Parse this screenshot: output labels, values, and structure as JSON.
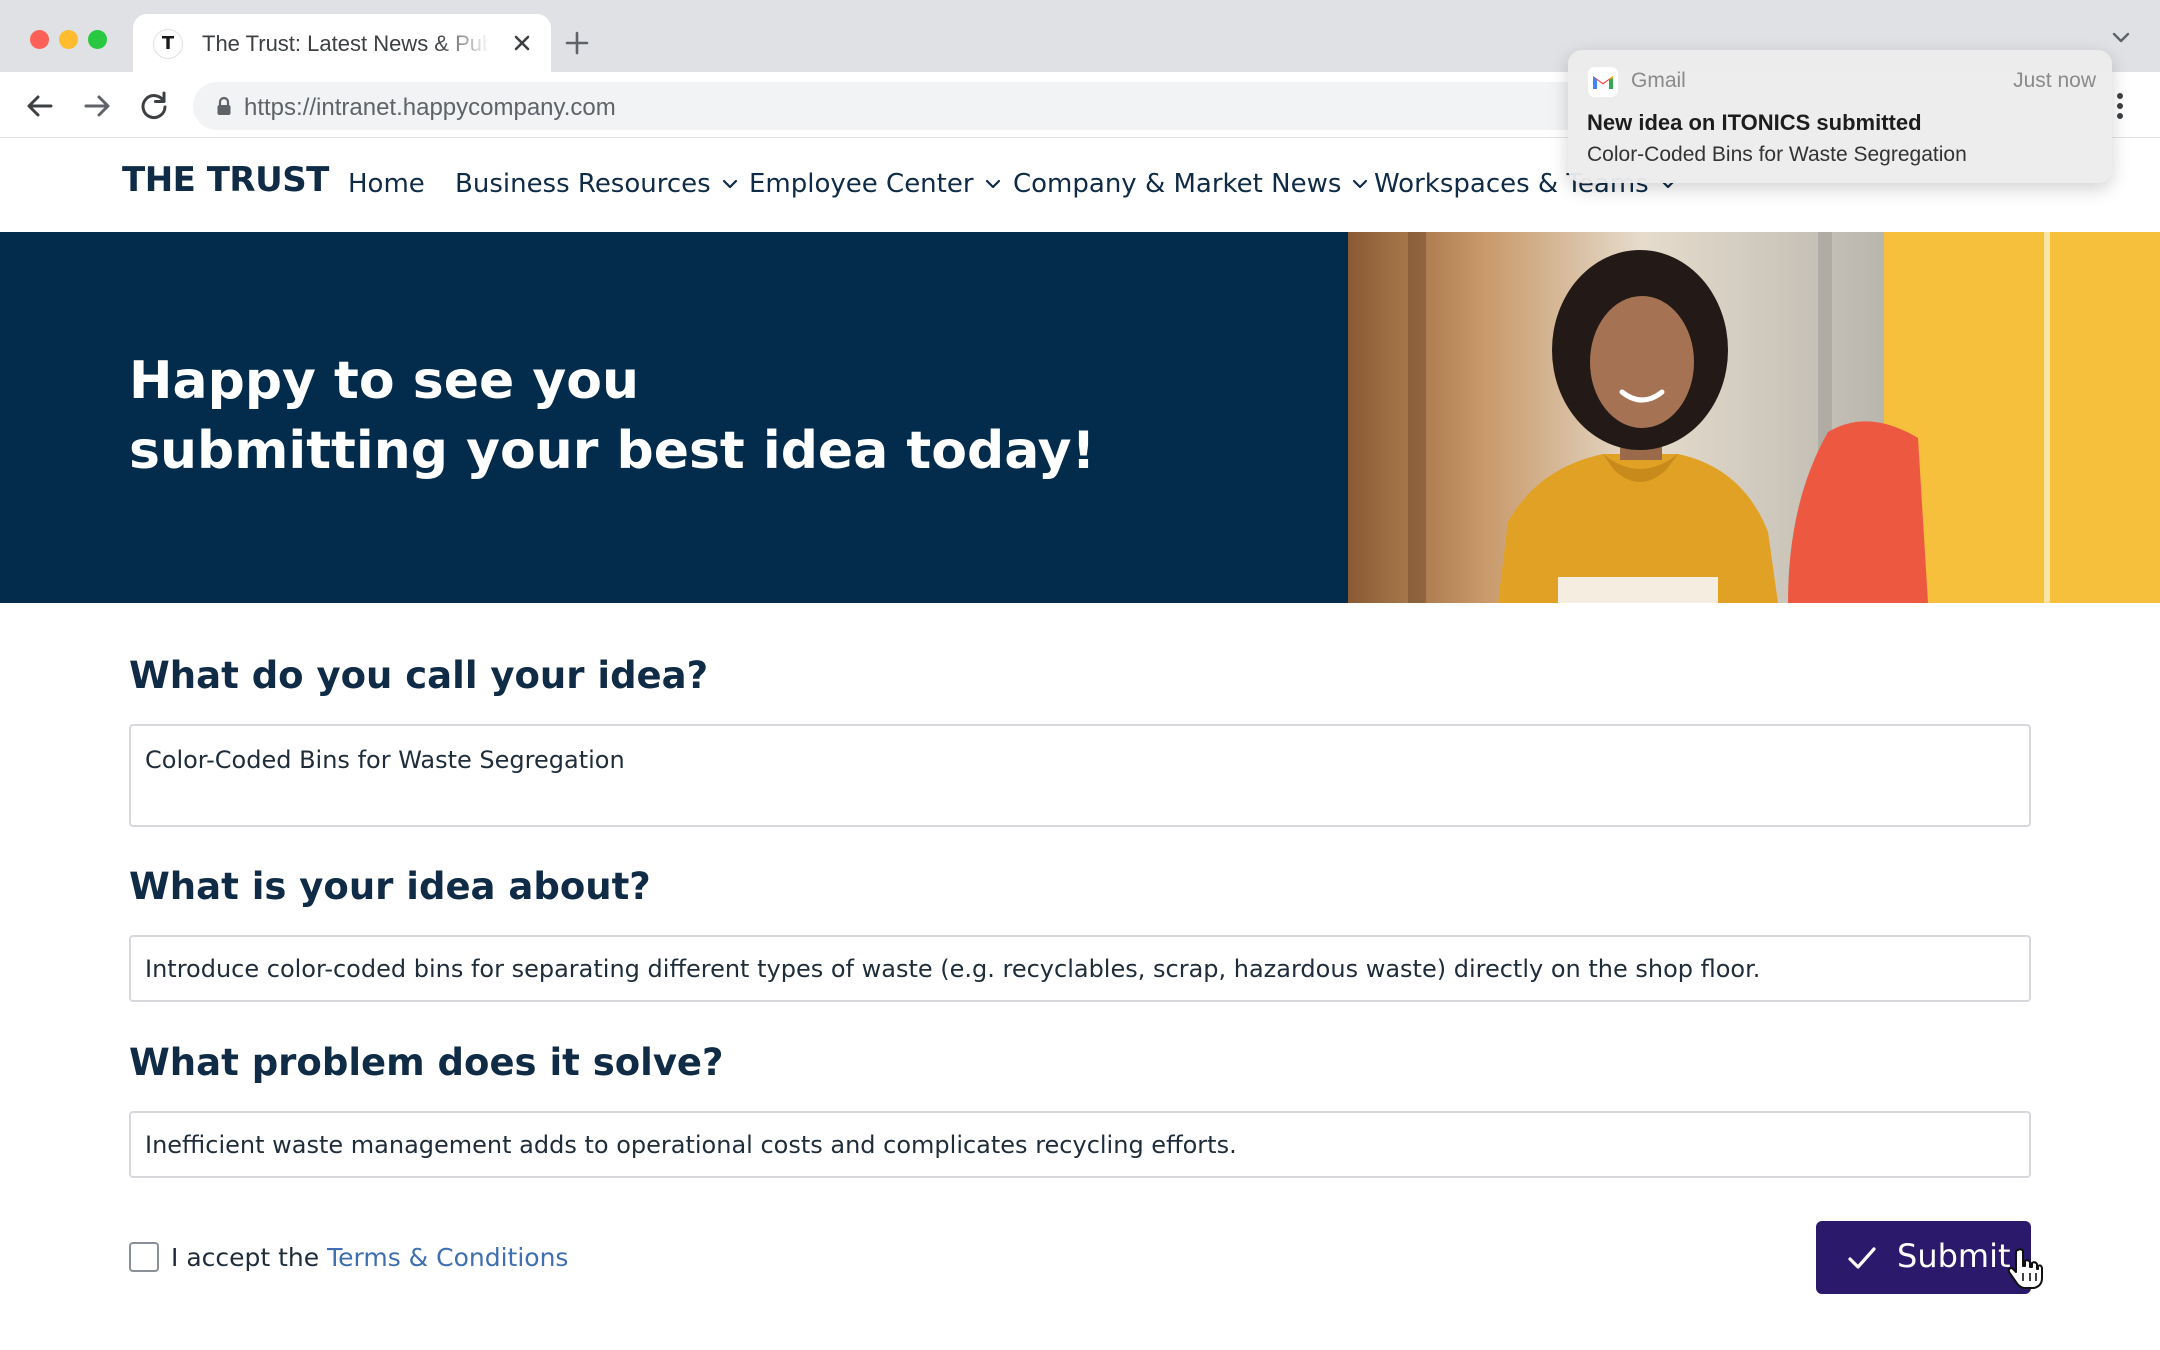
{
  "browser": {
    "tab_favicon": "T",
    "tab_title": "The Trust: Latest News & Public Updates",
    "url": "https://intranet.happycompany.com"
  },
  "site": {
    "logo": "THE TRUST",
    "nav": [
      {
        "label": "Home",
        "has_dropdown": false
      },
      {
        "label": "Business Resources",
        "has_dropdown": true
      },
      {
        "label": "Employee Center",
        "has_dropdown": true
      },
      {
        "label": "Company & Market News",
        "has_dropdown": true
      },
      {
        "label": "Workspaces & Teams",
        "has_dropdown": true
      }
    ]
  },
  "hero": {
    "line1": "Happy to see you",
    "line2": "submitting your best idea today!"
  },
  "form": {
    "q1": {
      "label": "What do you call your idea?",
      "value": "Color-Coded Bins for Waste Segregation"
    },
    "q2": {
      "label": "What is your idea about?",
      "value": "Introduce color-coded bins for separating different types of waste (e.g. recyclables, scrap, hazardous waste) directly on the shop floor."
    },
    "q3": {
      "label": "What problem does it solve?",
      "value": "Inefficient waste management adds to operational costs and complicates recycling efforts."
    },
    "accept_prefix": "I accept the ",
    "terms_link": "Terms & Conditions",
    "accepted": false,
    "submit_label": "Submit"
  },
  "notification": {
    "app": "Gmail",
    "time": "Just now",
    "title": "New idea on ITONICS submitted",
    "body": "Color-Coded Bins for Waste Segregation"
  },
  "colors": {
    "hero_bg": "#032c4c",
    "text_navy": "#0f2b46",
    "submit_bg": "#2b1a6b",
    "link": "#3e6fb0",
    "photo_yellow": "#f6bf3c"
  },
  "icons": [
    "close-icon",
    "plus-icon",
    "chevron-down-icon",
    "back-arrow-icon",
    "forward-arrow-icon",
    "reload-icon",
    "lock-icon",
    "more-vert-icon",
    "checkmark-icon",
    "gmail-icon",
    "hand-pointer-cursor-icon"
  ]
}
